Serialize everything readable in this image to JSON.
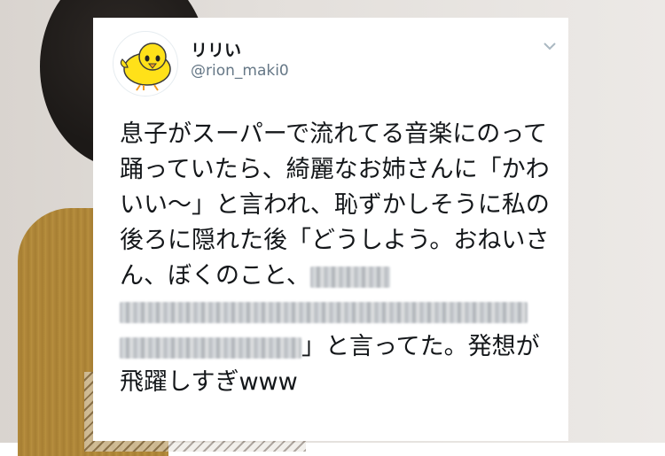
{
  "tweet": {
    "display_name": "リリい",
    "handle": "@rion_maki0",
    "text_part1": "息子がスーパーで流れてる音楽にのって踊っていたら、綺麗なお姉さんに「かわいい〜」と言われ、恥ずかしそうに私の後ろに隠れた後「どうしよう。おねいさん、ぼくのこと、",
    "text_part2": "」と言ってた。発想が飛躍しすぎwww"
  },
  "icons": {
    "avatar": "yellow-chick-avatar-icon",
    "menu": "chevron-down-icon"
  },
  "colors": {
    "card_background": "#ffffff",
    "name_text": "#14171a",
    "handle_text": "#657786",
    "chick_yellow": "#ffe119"
  }
}
